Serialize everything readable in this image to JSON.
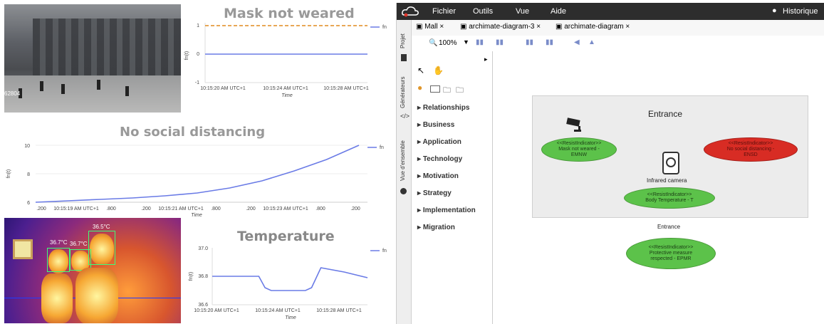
{
  "camera": {
    "corner_label": "62804"
  },
  "mask_chart": {
    "title": "Mask not weared",
    "legend": "fn",
    "ylabel": "fn(t)",
    "xlabel": "Time",
    "yticks": [
      "1",
      "0",
      "-1"
    ],
    "xticks": [
      "10:15:20 AM UTC+1",
      "10:15:24 AM UTC+1",
      "10:15:28 AM UTC+1"
    ]
  },
  "distance_chart": {
    "title": "No social distancing",
    "legend": "fn",
    "ylabel": "fn(t)",
    "xlabel": "Time",
    "yticks": [
      "10",
      "8",
      "6"
    ],
    "xticks": [
      ".200",
      "10:15:19 AM UTC+1",
      ".800",
      ".200",
      "10:15:21 AM UTC+1",
      ".800",
      ".200",
      "10:15:23 AM UTC+1",
      ".800",
      ".200"
    ]
  },
  "thermal": {
    "temps": [
      "36.5°C",
      "36.7°C",
      "36.7°C"
    ]
  },
  "temp_chart": {
    "title": "Temperature",
    "legend": "fn",
    "ylabel": "fn(t)",
    "xlabel": "Time",
    "yticks": [
      "37.0",
      "36.8",
      "36.6"
    ],
    "xticks": [
      "10:15:20 AM UTC+1",
      "10:15:24 AM UTC+1",
      "10:15:28 AM UTC+1"
    ]
  },
  "chart_data": [
    {
      "type": "line",
      "title": "Mask not weared",
      "xlabel": "Time",
      "ylabel": "fn(t)",
      "ylim": [
        -1,
        1
      ],
      "series": [
        {
          "name": "fn",
          "x": [
            0,
            1
          ],
          "values": [
            0,
            0
          ]
        }
      ],
      "threshold": 1
    },
    {
      "type": "line",
      "title": "No social distancing",
      "xlabel": "Time",
      "ylabel": "fn(t)",
      "ylim": [
        6,
        10
      ],
      "series": [
        {
          "name": "fn",
          "x": [
            0,
            0.1,
            0.2,
            0.3,
            0.4,
            0.5,
            0.6,
            0.7,
            0.8,
            0.9,
            1.0
          ],
          "values": [
            6.0,
            6.1,
            6.2,
            6.3,
            6.45,
            6.65,
            7.0,
            7.5,
            8.2,
            9.0,
            10.0
          ]
        }
      ]
    },
    {
      "type": "line",
      "title": "Temperature",
      "xlabel": "Time",
      "ylabel": "fn(t)",
      "ylim": [
        36.6,
        37.0
      ],
      "series": [
        {
          "name": "fn",
          "x": [
            0,
            0.3,
            0.34,
            0.38,
            0.6,
            0.64,
            0.7,
            0.85,
            1.0
          ],
          "values": [
            36.8,
            36.8,
            36.72,
            36.7,
            36.7,
            36.72,
            36.86,
            36.83,
            36.79
          ]
        }
      ]
    }
  ],
  "app": {
    "menu": [
      "Fichier",
      "Outils",
      "Vue",
      "Aide"
    ],
    "history": "Historique",
    "tabs": [
      "Mall",
      "archimate-diagram-3",
      "archimate-diagram"
    ],
    "zoom": "100%",
    "side_labels": [
      "Projet",
      "Générateurs",
      "Vue d'ensemble"
    ],
    "palette": [
      "Relationships",
      "Business",
      "Application",
      "Technology",
      "Motivation",
      "Strategy",
      "Implementation",
      "Migration"
    ],
    "diagram": {
      "group_title": "Entrance",
      "group_caption": "Entrance",
      "camera_label": "Infrared camera",
      "mask_ind": [
        "<<ResistIndicator>>",
        "Mask not weared -",
        "EMNW"
      ],
      "dist_ind": [
        "<<ResistIndicator>>",
        "No social distancing -",
        "ENSD"
      ],
      "temp_ind": [
        "<<ResistIndicator>>",
        "Body Temperature - T"
      ],
      "protect_ind": [
        "<<ResistIndicator>>",
        "Protective measure",
        "respected - EPMR"
      ]
    }
  }
}
